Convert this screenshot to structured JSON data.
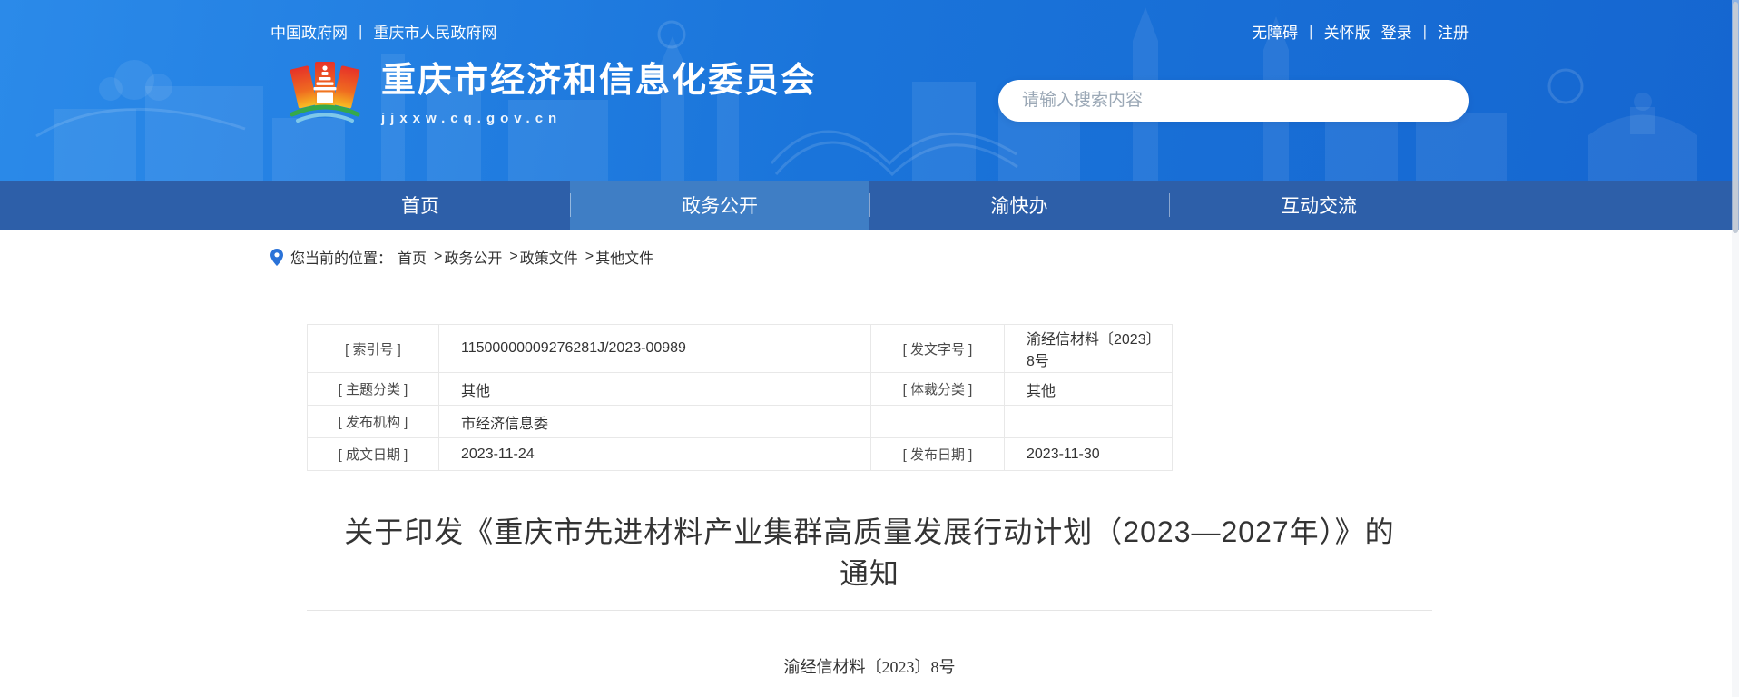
{
  "topbar": {
    "separator": "|",
    "left_links": [
      "中国政府网",
      "重庆市人民政府网"
    ],
    "right_links": [
      "无障碍",
      "关怀版",
      "登录",
      "注册"
    ]
  },
  "header": {
    "site_name": "重庆市经济和信息化委员会",
    "site_url": "jjxxw.cq.gov.cn",
    "search_placeholder": "请输入搜索内容"
  },
  "nav": {
    "items": [
      {
        "label": "首页"
      },
      {
        "label": "政务公开"
      },
      {
        "label": "渝快办"
      },
      {
        "label": "互动交流"
      }
    ]
  },
  "breadcrumb": {
    "location_label": "您当前的位置：",
    "separator": ">",
    "items": [
      "首页",
      "政务公开",
      "政策文件",
      "其他文件"
    ]
  },
  "doc_meta": {
    "rows": [
      {
        "label1": "[ 索引号 ]",
        "value1": "11500000009276281J/2023-00989",
        "label2": "[ 发文字号 ]",
        "value2": "渝经信材料〔2023〕8号"
      },
      {
        "label1": "[ 主题分类 ]",
        "value1": "其他",
        "label2": "[ 体裁分类 ]",
        "value2": "其他"
      },
      {
        "label1": "[ 发布机构 ]",
        "value1": "市经济信息委",
        "label2": "",
        "value2": ""
      },
      {
        "label1": "[ 成文日期 ]",
        "value1": "2023-11-24",
        "label2": "[ 发布日期 ]",
        "value2": "2023-11-30"
      }
    ]
  },
  "article": {
    "title": "关于印发《重庆市先进材料产业集群高质量发展行动计划（2023—2027年）》的通知",
    "doc_number": "渝经信材料〔2023〕8号"
  },
  "colors": {
    "banner_blue": "#1a74da",
    "nav_blue": "#2d5fa9",
    "nav_active_blue": "#3f7ec5",
    "pin_blue": "#2a72d8",
    "logo_red": "#e63229",
    "logo_orange": "#f2911f",
    "logo_green": "#35a94a"
  }
}
